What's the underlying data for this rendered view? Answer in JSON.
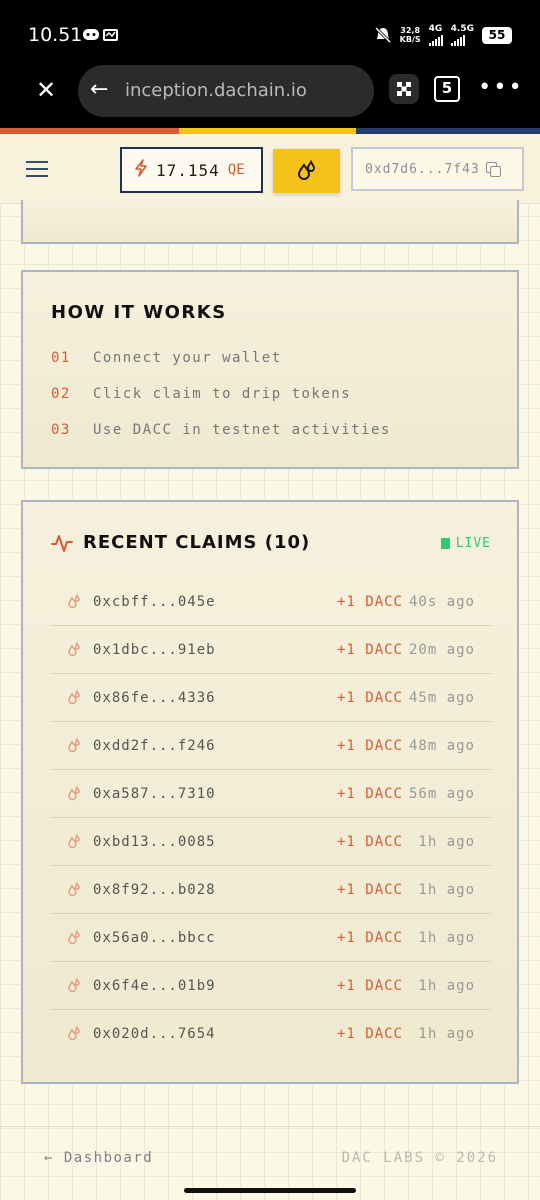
{
  "status_bar": {
    "time": "10.51",
    "speed_value": "32,8",
    "speed_unit": "KB/S",
    "net1": "4G",
    "net2": "4.5G",
    "battery": "55"
  },
  "browser": {
    "url": "inception.dachain.io",
    "tab_count": "5"
  },
  "header": {
    "balance_value": "17.154",
    "balance_unit": "QE",
    "wallet_address": "0xd7d6...7f43"
  },
  "how_it_works": {
    "title": "HOW IT WORKS",
    "steps": [
      {
        "num": "01",
        "text": "Connect your wallet"
      },
      {
        "num": "02",
        "text": "Click claim to drip tokens"
      },
      {
        "num": "03",
        "text": "Use DACC in testnet activities"
      }
    ]
  },
  "recent_claims": {
    "title": "RECENT CLAIMS (10)",
    "live_label": "LIVE",
    "rows": [
      {
        "address": "0xcbff...045e",
        "amount": "+1 DACC",
        "time": "40s ago"
      },
      {
        "address": "0x1dbc...91eb",
        "amount": "+1 DACC",
        "time": "20m ago"
      },
      {
        "address": "0x86fe...4336",
        "amount": "+1 DACC",
        "time": "45m ago"
      },
      {
        "address": "0xdd2f...f246",
        "amount": "+1 DACC",
        "time": "48m ago"
      },
      {
        "address": "0xa587...7310",
        "amount": "+1 DACC",
        "time": "56m ago"
      },
      {
        "address": "0xbd13...0085",
        "amount": "+1 DACC",
        "time": "1h ago"
      },
      {
        "address": "0x8f92...b028",
        "amount": "+1 DACC",
        "time": "1h ago"
      },
      {
        "address": "0x56a0...bbcc",
        "amount": "+1 DACC",
        "time": "1h ago"
      },
      {
        "address": "0x6f4e...01b9",
        "amount": "+1 DACC",
        "time": "1h ago"
      },
      {
        "address": "0x020d...7654",
        "amount": "+1 DACC",
        "time": "1h ago"
      }
    ]
  },
  "footer": {
    "back_link": "← Dashboard",
    "copyright": "DAC LABS © 2026"
  },
  "colors": {
    "accent_orange": "#d85b35",
    "accent_yellow": "#f5c21a",
    "navy": "#1f3050",
    "live_green": "#2ecc71"
  },
  "icons": {
    "close": "close-icon",
    "back": "arrow-left-icon",
    "menu": "hamburger-icon",
    "bolt": "lightning-icon",
    "drop": "drops-icon",
    "copy": "copy-icon",
    "activity": "activity-pulse-icon"
  }
}
